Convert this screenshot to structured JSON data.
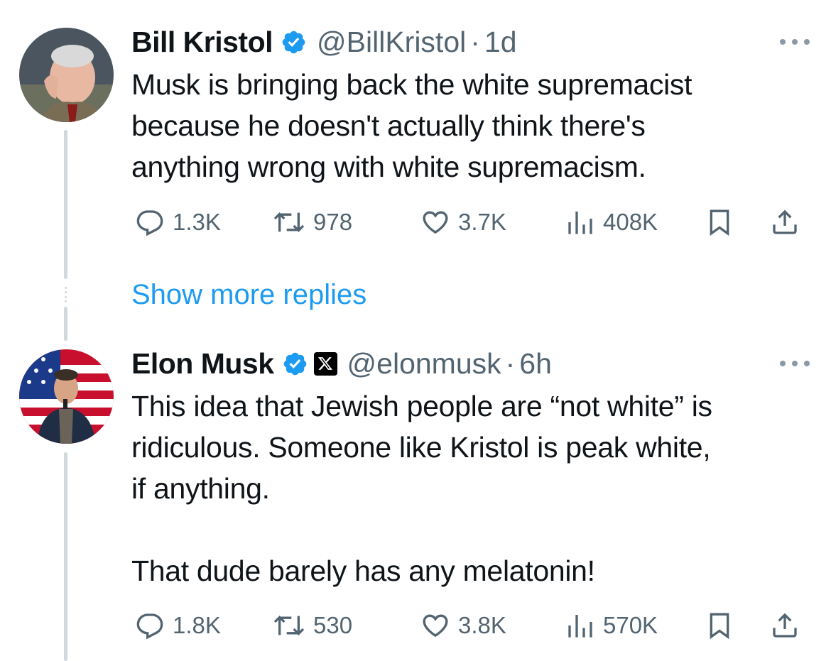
{
  "tweets": [
    {
      "name": "Bill Kristol",
      "handle": "@BillKristol",
      "separator": "·",
      "time": "1d",
      "verified": true,
      "has_x_badge": false,
      "text": "Musk is bringing back the white supremacist\nbecause he doesn't actually think there's\nanything wrong with white supremacism.",
      "stats": {
        "replies": "1.3K",
        "reposts": "978",
        "likes": "3.7K",
        "views": "408K"
      },
      "icons": {
        "reply": "reply-icon",
        "repost": "repost-icon",
        "like": "heart-icon",
        "views": "views-icon",
        "bookmark": "bookmark-icon",
        "share": "share-icon",
        "more": "more-icon"
      }
    },
    {
      "name": "Elon Musk",
      "handle": "@elonmusk",
      "separator": "·",
      "time": "6h",
      "verified": true,
      "has_x_badge": true,
      "text": "This idea that Jewish people are “not white” is\nridiculous. Someone like Kristol is peak white,\nif anything.\n\nThat dude barely has any melatonin!",
      "stats": {
        "replies": "1.8K",
        "reposts": "530",
        "likes": "3.8K",
        "views": "570K"
      },
      "icons": {
        "reply": "reply-icon",
        "repost": "repost-icon",
        "like": "heart-icon",
        "views": "views-icon",
        "bookmark": "bookmark-icon",
        "share": "share-icon",
        "more": "more-icon"
      }
    }
  ],
  "show_more_replies": "Show more replies",
  "colors": {
    "text": "#0f1419",
    "secondary": "#536471",
    "link": "#1d9bf0",
    "verified": "#1d9bf0",
    "thread_line": "#cfd9de"
  }
}
